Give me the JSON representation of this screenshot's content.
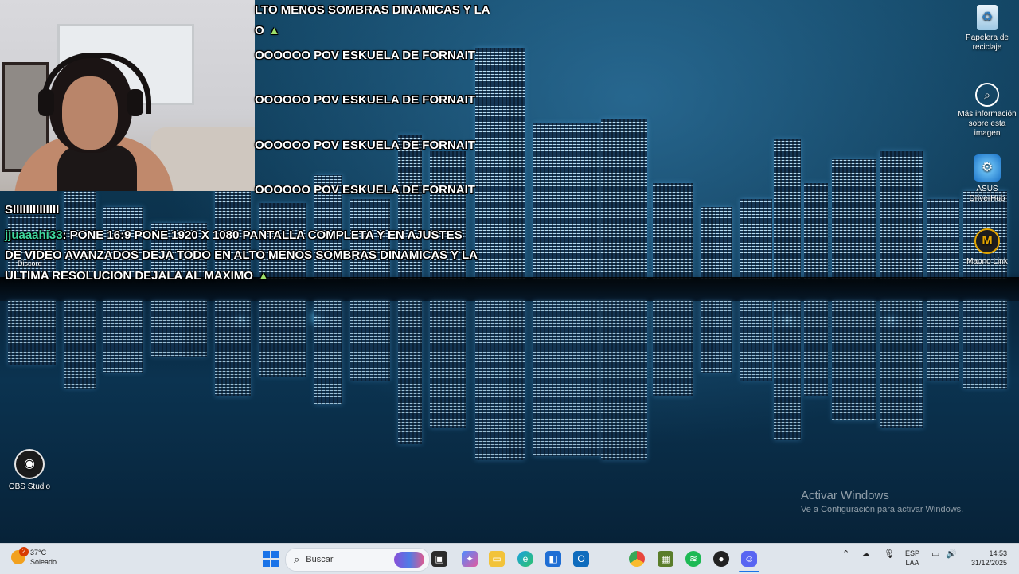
{
  "chat": {
    "lines": [
      {
        "text": "LTO MENOS SOMBRAS DINAMICAS Y LA"
      },
      {
        "text": "O"
      },
      {
        "text": "OOOOOO POV ESKUELA DE FORNAIT"
      },
      {
        "text": "OOOOOO POV ESKUELA DE FORNAIT"
      },
      {
        "text": "OOOOOO POV ESKUELA DE FORNAIT"
      },
      {
        "text": "OOOOOO POV ESKUELA DE FORNAIT"
      },
      {
        "text": "SIIIIIIIIIIIIII"
      }
    ],
    "user": "jjuaaahi33",
    "message_line1": ": PONE 16:9 PONE 1920 X 1080 PANTALLA COMPLETA Y EN AJUSTES",
    "message_line2": "DE VIDEO AVANZADOS DEJA TODO EN ALTO MENOS SOMBRAS DINAMICAS Y LA",
    "message_line3": "ULTIMA RESOLUCION DEJALA AL MAXIMO",
    "discord_label": "Discord",
    "warn_icon": "warning-icon"
  },
  "desktop_icons": [
    {
      "label": "Papelera de reciclaje",
      "icon": "recycle-bin-icon"
    },
    {
      "label": "Más información sobre esta imagen",
      "icon": "info-camera-icon"
    },
    {
      "label": "ASUS DriverHub",
      "icon": "asus-driverhub-icon"
    },
    {
      "label": "Maono Link",
      "icon": "maono-link-icon"
    },
    {
      "label": "OBS Studio",
      "icon": "obs-studio-icon"
    }
  ],
  "activation": {
    "title": "Activar Windows",
    "subtitle": "Ve a Configuración para activar Windows."
  },
  "taskbar": {
    "weather_temp": "37°C",
    "weather_cond": "Soleado",
    "weather_badge": "2",
    "search_placeholder": "Buscar",
    "lang_top": "ESP",
    "lang_bottom": "LAA",
    "time": "14:53",
    "date": "31/12/2025"
  },
  "colors": {
    "accent": "#1a73e8",
    "chat_user": "#3fd9a0",
    "taskbar_bg": "#dfe5ec"
  }
}
